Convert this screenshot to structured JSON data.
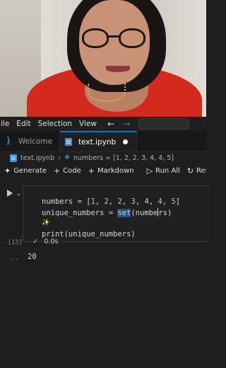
{
  "webcam": {
    "description_icon": "presenter-webcam"
  },
  "menubar": {
    "items": [
      "ile",
      "Edit",
      "Selection",
      "View"
    ],
    "back_icon": "←",
    "forward_icon": "→"
  },
  "tabs": [
    {
      "label": "Welcome",
      "icon": "vscode-logo-icon",
      "active": false
    },
    {
      "label": "text.ipynb",
      "icon": "notebook-icon",
      "active": true,
      "unsaved": true
    }
  ],
  "breadcrumb": {
    "file": "text.ipynb",
    "separator": "›",
    "symbol": "numbers = [1, 2, 2, 3, 4, 4, 5]"
  },
  "toolbar": {
    "generate": "Generate",
    "code": "Code",
    "markdown": "Markdown",
    "run_all": "Run All",
    "restart": "Resta"
  },
  "cell": {
    "code_lines": {
      "line1_prefix": "numbers = [",
      "line1_nums": [
        "1",
        "2",
        "2",
        "3",
        "4",
        "4",
        "5"
      ],
      "line2_a": "unique_numbers = ",
      "line2_set": "set",
      "line2_b": "(numbe",
      "line2_c": "rs)",
      "line4": "print(unique_numbers)"
    },
    "exec_count": "[13]",
    "duration": "0.0s",
    "output": "20",
    "output_menu": "..."
  }
}
